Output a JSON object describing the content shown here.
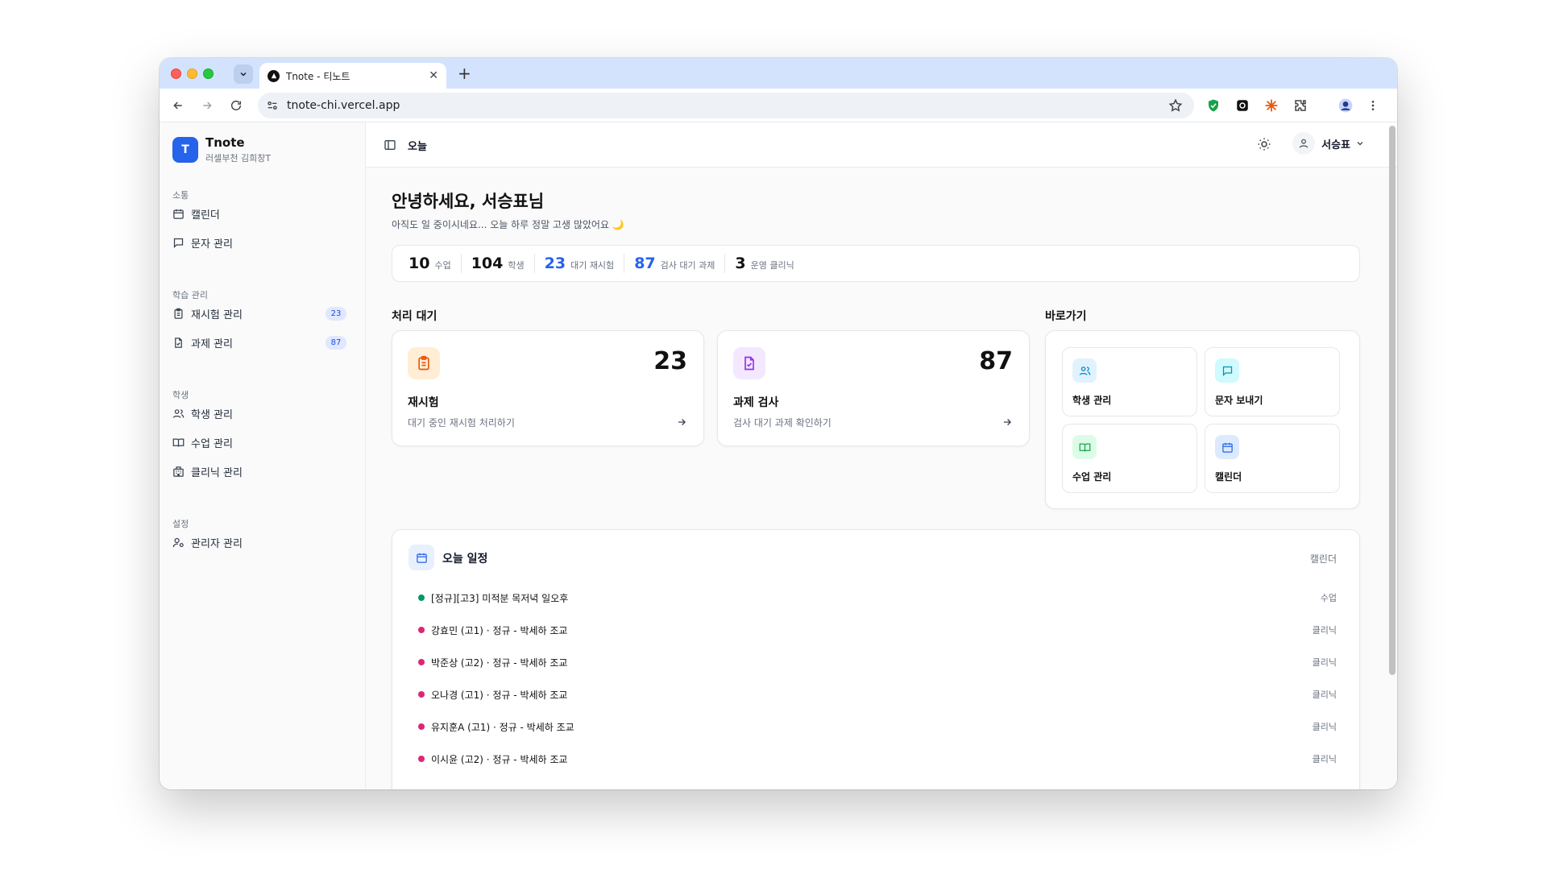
{
  "browser": {
    "tab_title": "Tnote - 티노트",
    "url": "tnote-chi.vercel.app"
  },
  "sidebar": {
    "brand_initial": "T",
    "brand_name": "Tnote",
    "brand_sub": "러셀부천 김희창T",
    "sections": [
      {
        "label": "소통",
        "items": [
          {
            "label": "캘린더",
            "icon": "calendar-icon"
          },
          {
            "label": "문자 관리",
            "icon": "message-square-icon"
          }
        ]
      },
      {
        "label": "학습 관리",
        "items": [
          {
            "label": "재시험 관리",
            "icon": "clipboard-icon",
            "badge": "23"
          },
          {
            "label": "과제 관리",
            "icon": "file-check-icon",
            "badge": "87"
          }
        ]
      },
      {
        "label": "학생",
        "items": [
          {
            "label": "학생 관리",
            "icon": "users-icon"
          },
          {
            "label": "수업 관리",
            "icon": "book-open-icon"
          },
          {
            "label": "클리닉 관리",
            "icon": "building-icon"
          }
        ]
      },
      {
        "label": "설정",
        "items": [
          {
            "label": "관리자 관리",
            "icon": "user-cog-icon"
          }
        ]
      }
    ]
  },
  "topbar": {
    "title": "오늘",
    "user_name": "서승표"
  },
  "greeting": {
    "title": "안녕하세요, 서승표님",
    "subtitle": "아직도 일 중이시네요... 오늘 하루 정말 고생 많았어요 🌙"
  },
  "stats": [
    {
      "value": "10",
      "label": "수업",
      "accent": false
    },
    {
      "value": "104",
      "label": "학생",
      "accent": false
    },
    {
      "value": "23",
      "label": "대기 재시험",
      "accent": true
    },
    {
      "value": "87",
      "label": "검사 대기 과제",
      "accent": true
    },
    {
      "value": "3",
      "label": "운영 클리닉",
      "accent": false
    }
  ],
  "pending": {
    "heading": "처리 대기",
    "cards": [
      {
        "count": "23",
        "title": "재시험",
        "desc": "대기 중인 재시험 처리하기",
        "icon": "clipboard-icon",
        "color": "#ea580c",
        "bg": "#ffedd5"
      },
      {
        "count": "87",
        "title": "과제 검사",
        "desc": "검사 대기 과제 확인하기",
        "icon": "file-check-icon",
        "color": "#9333ea",
        "bg": "#f3e8ff"
      }
    ]
  },
  "shortcuts": {
    "heading": "바로가기",
    "items": [
      {
        "label": "학생 관리",
        "icon": "users-icon",
        "color": "#0284c7",
        "bg": "#e0f2fe"
      },
      {
        "label": "문자 보내기",
        "icon": "message-square-icon",
        "color": "#0891b2",
        "bg": "#cffafe"
      },
      {
        "label": "수업 관리",
        "icon": "book-open-icon",
        "color": "#16a34a",
        "bg": "#dcfce7"
      },
      {
        "label": "캘린더",
        "icon": "calendar-icon",
        "color": "#2563eb",
        "bg": "#dbeafe"
      }
    ]
  },
  "schedule": {
    "heading": "오늘 일정",
    "link": "캘린더",
    "events": [
      {
        "title": "[정규][고3] 미적분 목저녁 일오후",
        "tag": "수업",
        "color": "#059669"
      },
      {
        "title": "강효민 (고1) · 정규 - 박세하 조교",
        "tag": "클리닉",
        "color": "#db2777"
      },
      {
        "title": "박준상 (고2) · 정규 - 박세하 조교",
        "tag": "클리닉",
        "color": "#db2777"
      },
      {
        "title": "오나경 (고1) · 정규 - 박세하 조교",
        "tag": "클리닉",
        "color": "#db2777"
      },
      {
        "title": "유지훈A (고1) · 정규 - 박세하 조교",
        "tag": "클리닉",
        "color": "#db2777"
      },
      {
        "title": "이시윤 (고2) · 정규 - 박세하 조교",
        "tag": "클리닉",
        "color": "#db2777"
      }
    ]
  }
}
